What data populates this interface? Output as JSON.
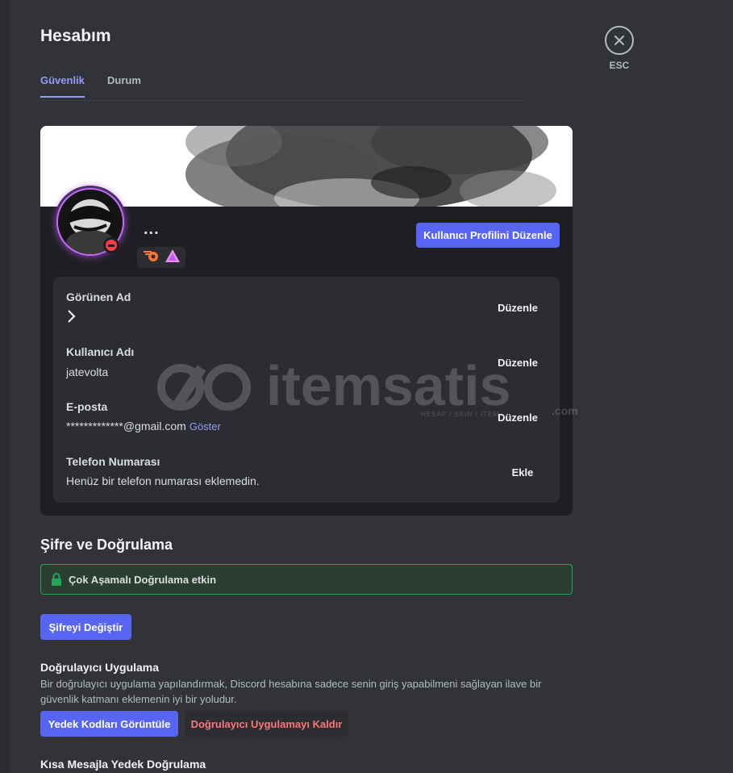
{
  "page": {
    "title": "Hesabım"
  },
  "tabs": [
    {
      "label": "Güvenlik",
      "active": true
    },
    {
      "label": "Durum",
      "active": false
    }
  ],
  "close": {
    "label": "ESC",
    "icon": "close-icon"
  },
  "profile": {
    "more_label": "...",
    "edit_profile_label": "Kullanıcı Profilini Düzenle",
    "status": "do-not-disturb",
    "badges": [
      "hypesquad-badge",
      "nitro-badge"
    ]
  },
  "fields": {
    "display_name": {
      "label": "Görünen Ad",
      "value": ">",
      "button": "Düzenle"
    },
    "username": {
      "label": "Kullanıcı Adı",
      "value": "jatevolta",
      "button": "Düzenle"
    },
    "email": {
      "label": "E-posta",
      "value": "*************@gmail.com",
      "reveal": "Göster",
      "button": "Düzenle"
    },
    "phone": {
      "label": "Telefon Numarası",
      "value": "Henüz bir telefon numarası eklemedin.",
      "button": "Ekle"
    }
  },
  "security": {
    "title": "Şifre ve Doğrulama",
    "mfa_status": "Çok Aşamalı Doğrulama etkin",
    "change_password": "Şifreyi Değiştir",
    "authenticator_title": "Doğrulayıcı Uygulama",
    "authenticator_desc": "Bir doğrulayıcı uygulama yapılandırmak, Discord hesabına sadece senin giriş yapabilmeni sağlayan ilave bir güvenlik katmanı eklemenin iyi bir yoludur.",
    "backup_codes": "Yedek Kodları Görüntüle",
    "remove_authenticator": "Doğrulayıcı Uygulamayı Kaldır",
    "sms_title": "Kısa Mesajla Yedek Doğrulama"
  },
  "watermark": {
    "brand": "itemsatis",
    "suffix": ".com",
    "tagline": "HESAP / SKIN / ITEM"
  },
  "colors": {
    "accent": "#5865f2",
    "link": "#949cf7",
    "danger": "#fa777c",
    "success": "#23a55a",
    "background": "#313338"
  }
}
